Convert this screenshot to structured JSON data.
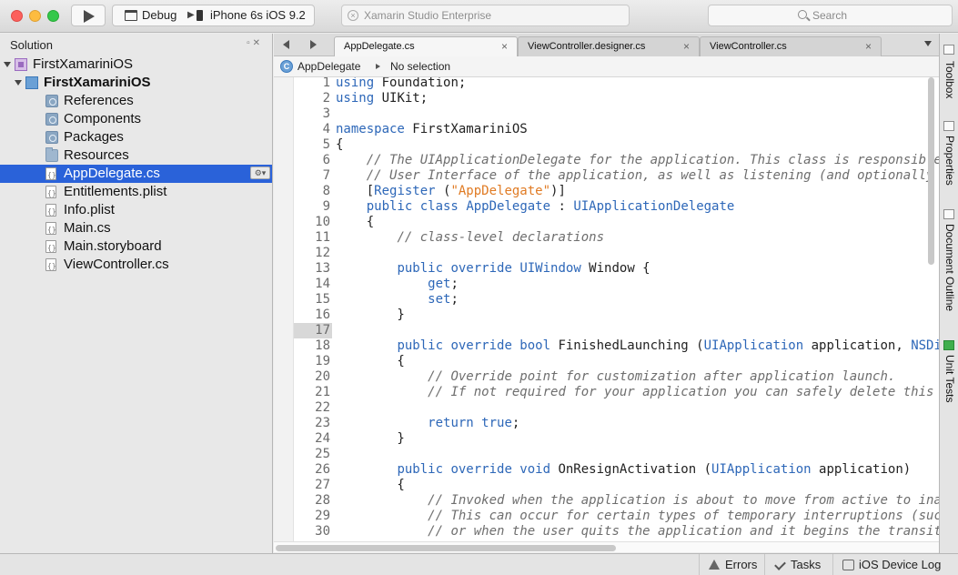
{
  "toolbar": {
    "run_icon": "play-icon",
    "configuration": "Debug",
    "device": "iPhone 6s iOS 9.2",
    "status_text": "Xamarin Studio Enterprise",
    "search_placeholder": "Search"
  },
  "solution": {
    "title": "Solution",
    "items": [
      {
        "label": "FirstXamariniOS",
        "icon": "solution-icon",
        "expander": "expanded"
      },
      {
        "label": "FirstXamariniOS",
        "icon": "project-icon",
        "expander": "expanded",
        "bold": true
      },
      {
        "label": "References",
        "icon": "references-folder-icon",
        "expander": "collapsed"
      },
      {
        "label": "Components",
        "icon": "components-folder-icon",
        "expander": "none"
      },
      {
        "label": "Packages",
        "icon": "packages-folder-icon",
        "expander": "none"
      },
      {
        "label": "Resources",
        "icon": "folder-icon",
        "expander": "collapsed"
      },
      {
        "label": "AppDelegate.cs",
        "icon": "cs-file-icon",
        "expander": "none",
        "selected": true
      },
      {
        "label": "Entitlements.plist",
        "icon": "file-icon",
        "expander": "none"
      },
      {
        "label": "Info.plist",
        "icon": "plist-file-icon",
        "expander": "none"
      },
      {
        "label": "Main.cs",
        "icon": "cs-file-icon",
        "expander": "none"
      },
      {
        "label": "Main.storyboard",
        "icon": "storyboard-file-icon",
        "expander": "none"
      },
      {
        "label": "ViewController.cs",
        "icon": "cs-file-icon",
        "expander": "collapsed"
      }
    ]
  },
  "tabs": [
    {
      "label": "AppDelegate.cs",
      "active": true
    },
    {
      "label": "ViewController.designer.cs",
      "active": false
    },
    {
      "label": "ViewController.cs",
      "active": false
    }
  ],
  "pathbar": {
    "class_name": "AppDelegate",
    "member": "No selection"
  },
  "editor": {
    "current_line": 17,
    "lines": [
      {
        "n": "1",
        "html": "<span class='kw'>using</span> Foundation;"
      },
      {
        "n": "2",
        "html": "<span class='kw'>using</span> UIKit;"
      },
      {
        "n": "3",
        "html": ""
      },
      {
        "n": "4",
        "html": "<span class='kw'>namespace</span> FirstXamariniOS"
      },
      {
        "n": "5",
        "html": "{"
      },
      {
        "n": "6",
        "html": "    <span class='cm'>// The UIApplicationDelegate for the application. This class is responsible for launching the</span>"
      },
      {
        "n": "7",
        "html": "    <span class='cm'>// User Interface of the application, as well as listening (and optionally responding) to</span>"
      },
      {
        "n": "8",
        "html": "    [<span class='ty'>Register</span> (<span class='str'>\"AppDelegate\"</span>)]"
      },
      {
        "n": "9",
        "html": "    <span class='kw'>public class</span> <span class='ty'>AppDelegate</span> : <span class='ty'>UIApplicationDelegate</span>"
      },
      {
        "n": "10",
        "html": "    {"
      },
      {
        "n": "11",
        "html": "        <span class='cm'>// class-level declarations</span>"
      },
      {
        "n": "12",
        "html": ""
      },
      {
        "n": "13",
        "html": "        <span class='kw'>public override</span> <span class='ty'>UIWindow</span> Window {"
      },
      {
        "n": "14",
        "html": "            <span class='kw'>get</span>;"
      },
      {
        "n": "15",
        "html": "            <span class='kw'>set</span>;"
      },
      {
        "n": "16",
        "html": "        }"
      },
      {
        "n": "17",
        "html": ""
      },
      {
        "n": "18",
        "html": "        <span class='kw'>public override bool</span> FinishedLaunching (<span class='ty'>UIApplication</span> application, <span class='ty'>NSDictionary</span> launchOptions)"
      },
      {
        "n": "19",
        "html": "        {"
      },
      {
        "n": "20",
        "html": "            <span class='cm'>// Override point for customization after application launch.</span>"
      },
      {
        "n": "21",
        "html": "            <span class='cm'>// If not required for your application you can safely delete this method</span>"
      },
      {
        "n": "22",
        "html": ""
      },
      {
        "n": "23",
        "html": "            <span class='kw'>return true</span>;"
      },
      {
        "n": "24",
        "html": "        }"
      },
      {
        "n": "25",
        "html": ""
      },
      {
        "n": "26",
        "html": "        <span class='kw'>public override void</span> OnResignActivation (<span class='ty'>UIApplication</span> application)"
      },
      {
        "n": "27",
        "html": "        {"
      },
      {
        "n": "28",
        "html": "            <span class='cm'>// Invoked when the application is about to move from active to inactive state.</span>"
      },
      {
        "n": "29",
        "html": "            <span class='cm'>// This can occur for certain types of temporary interruptions (such as an incoming phone call or SMS message)</span>"
      },
      {
        "n": "30",
        "html": "            <span class='cm'>// or when the user quits the application and it begins the transition to the background state.</span>"
      }
    ]
  },
  "dock": [
    {
      "label": "Toolbox",
      "icon": "toolbox-icon"
    },
    {
      "label": "Properties",
      "icon": "properties-icon"
    },
    {
      "label": "Document Outline",
      "icon": "document-outline-icon"
    },
    {
      "label": "Unit Tests",
      "icon": "unit-tests-icon"
    }
  ],
  "statusbar": {
    "errors": "Errors",
    "tasks": "Tasks",
    "device_log": "iOS Device Log"
  },
  "colors": {
    "selection": "#2a62d9",
    "keyword": "#2d67b8",
    "string": "#e07b24",
    "comment": "#6e6e6e"
  }
}
